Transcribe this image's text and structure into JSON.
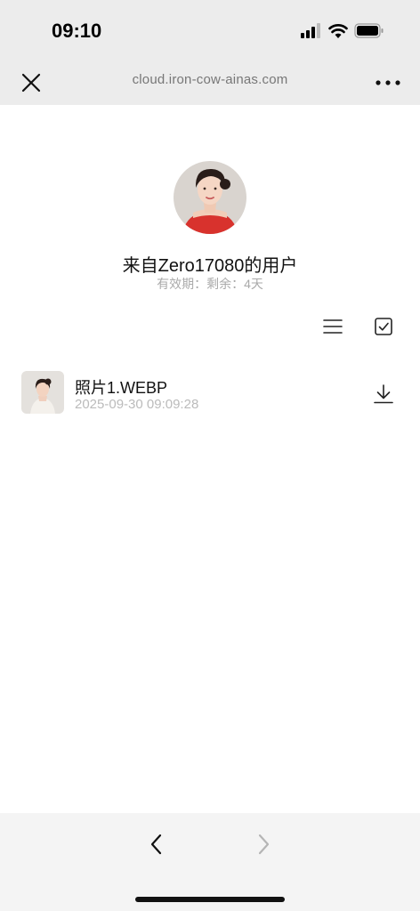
{
  "status_bar": {
    "time": "09:10",
    "icons": [
      "signal-icon",
      "wifi-icon",
      "battery-icon"
    ]
  },
  "nav_bar": {
    "url": "cloud.iron-cow-ainas.com",
    "close_icon": "close-icon",
    "more_icon": "more-icon"
  },
  "share": {
    "title": "来自Zero17080的用户",
    "expiry": "有效期：剩余：4天"
  },
  "toolbar": {
    "list_icon": "list-view-icon",
    "select_icon": "checkbox-icon"
  },
  "files": [
    {
      "name": "照片1.WEBP",
      "date": "2025-09-30 09:09:28",
      "action_icon": "download-icon"
    }
  ],
  "bottom_bar": {
    "back_icon": "chevron-left-icon",
    "forward_icon": "chevron-right-icon"
  },
  "colors": {
    "bar_background": "#ececec",
    "bottom_background": "#f4f4f4",
    "muted_text": "#aaaaaa"
  }
}
